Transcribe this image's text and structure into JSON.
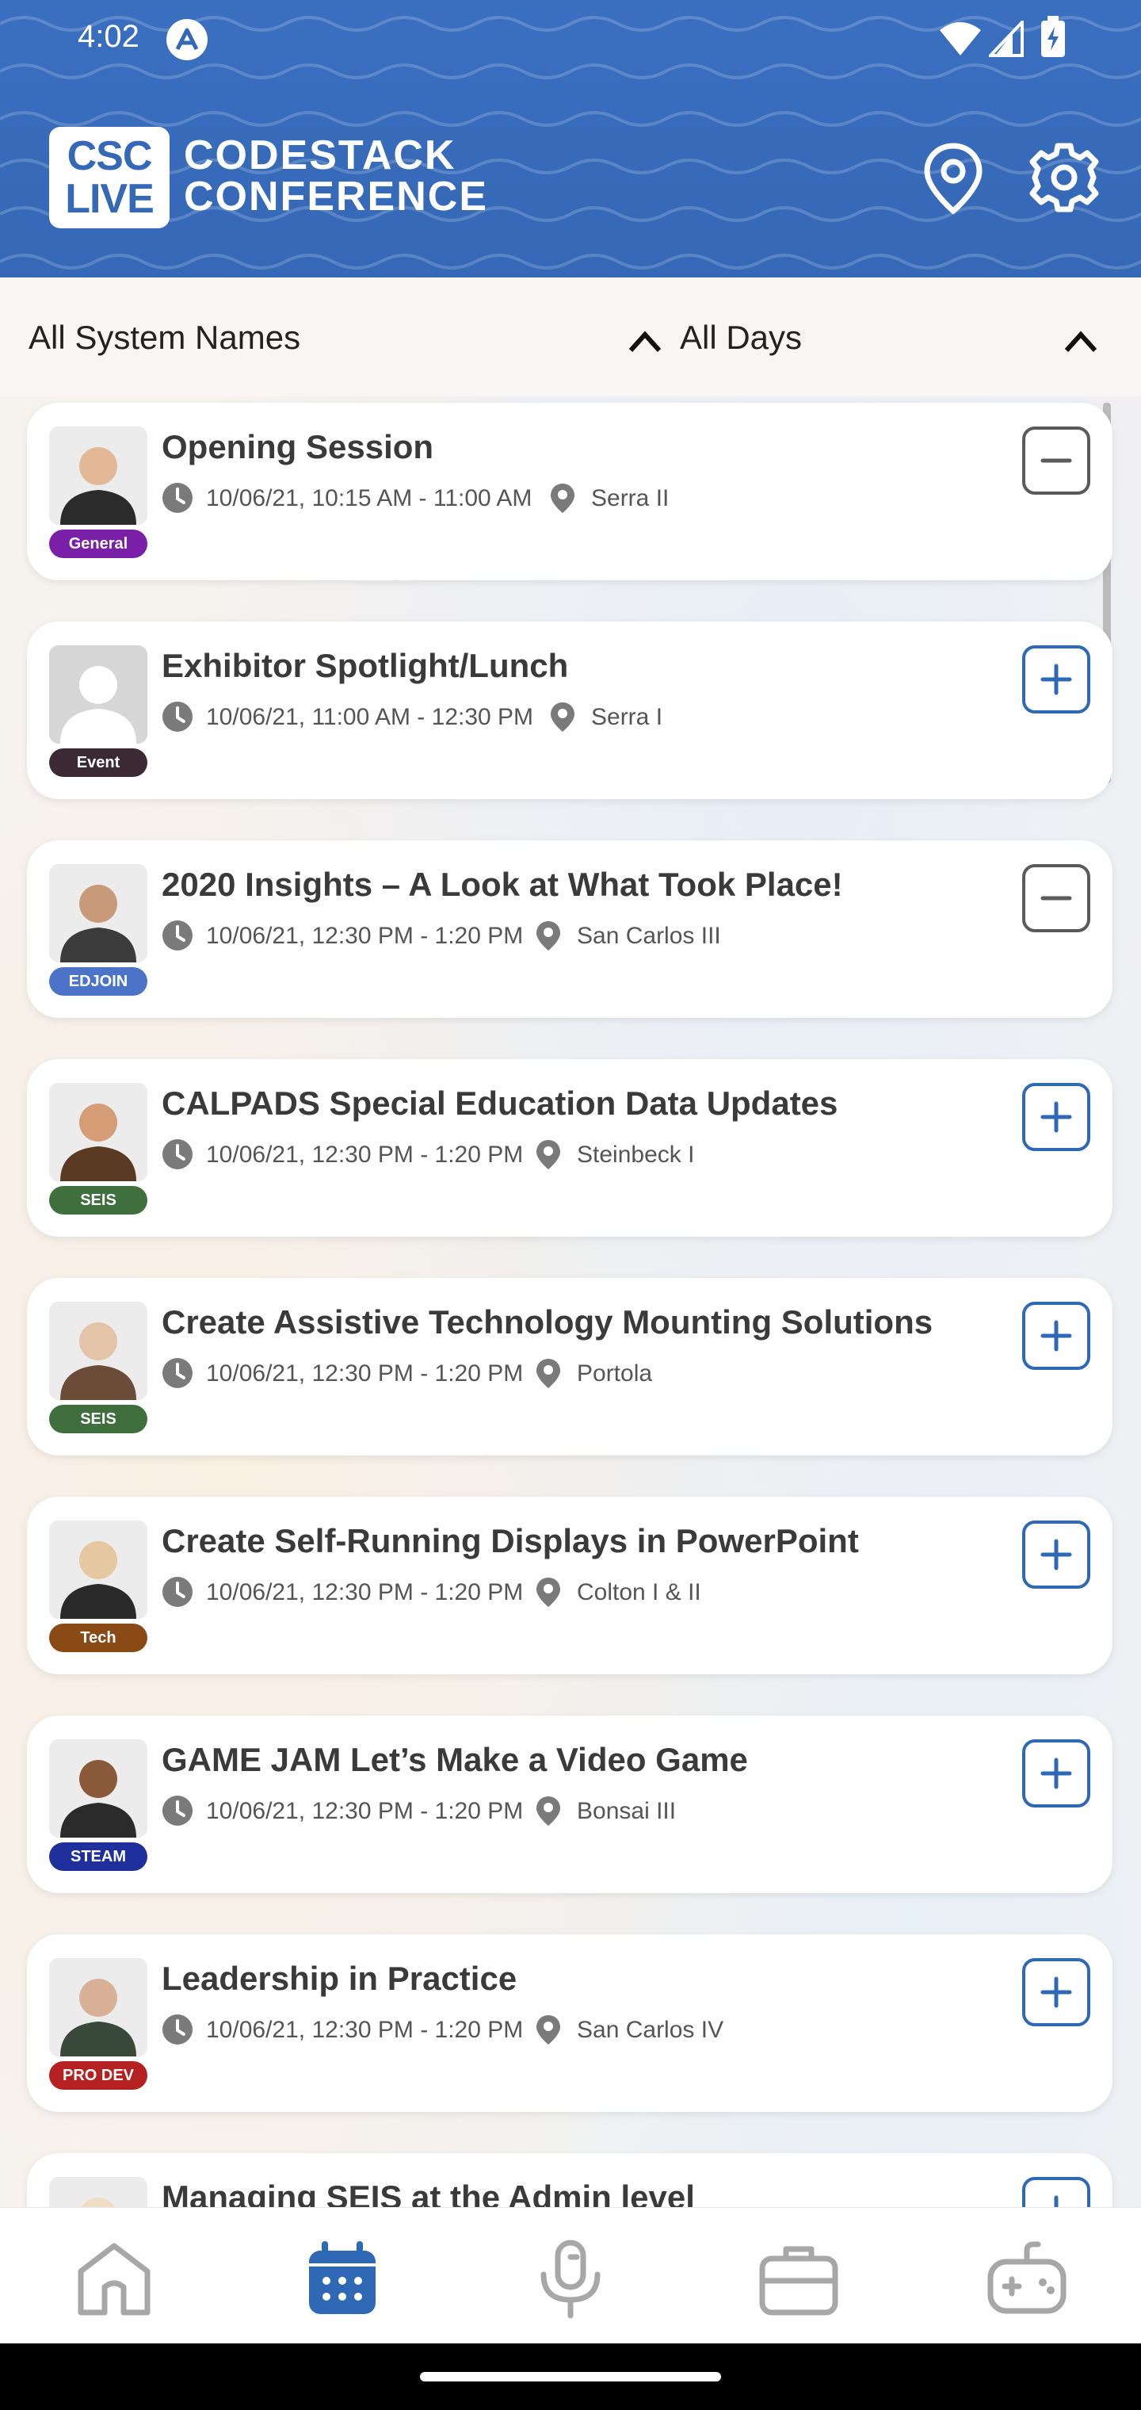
{
  "status_bar": {
    "time": "4:02"
  },
  "header": {
    "logo_badge_line1": "CSC",
    "logo_badge_line2": "LIVE",
    "logo_line1": "CODESTACK",
    "logo_line2": "CONFERENCE",
    "colors": {
      "header_bg": "#3568b6",
      "accent": "#2f68b4"
    }
  },
  "filters": {
    "system_names": "All System Names",
    "days": "All Days"
  },
  "sessions": [
    {
      "title": "Opening Session",
      "time": "10/06/21, 10:15 AM - 11:00 AM",
      "room": "Serra II",
      "tag": "General",
      "tag_color": "#7a1fa8",
      "action": "remove"
    },
    {
      "title": "Exhibitor Spotlight/Lunch",
      "time": "10/06/21, 11:00 AM - 12:30 PM",
      "room": "Serra I",
      "tag": "Event",
      "tag_color": "#3b2a33",
      "action": "add"
    },
    {
      "title": "2020 Insights – A Look at What Took Place!",
      "time": "10/06/21, 12:30 PM - 1:20 PM",
      "room": "San Carlos III",
      "tag": "EDJOIN",
      "tag_color": "#4b74c8",
      "action": "remove"
    },
    {
      "title": "CALPADS Special Education Data Updates",
      "time": "10/06/21, 12:30 PM - 1:20 PM",
      "room": "Steinbeck I",
      "tag": "SEIS",
      "tag_color": "#3f6f3c",
      "action": "add"
    },
    {
      "title": "Create Assistive Technology Mounting Solutions",
      "time": "10/06/21, 12:30 PM - 1:20 PM",
      "room": "Portola",
      "tag": "SEIS",
      "tag_color": "#3f6f3c",
      "action": "add"
    },
    {
      "title": "Create Self-Running Displays in PowerPoint",
      "time": "10/06/21, 12:30 PM - 1:20 PM",
      "room": "Colton I & II",
      "tag": "Tech",
      "tag_color": "#8a4a16",
      "action": "add"
    },
    {
      "title": "GAME JAM Let’s Make a Video Game",
      "time": "10/06/21, 12:30 PM - 1:20 PM",
      "room": "Bonsai III",
      "tag": "STEAM",
      "tag_color": "#1f2f9c",
      "action": "add"
    },
    {
      "title": "Leadership in Practice",
      "time": "10/06/21, 12:30 PM - 1:20 PM",
      "room": "San Carlos IV",
      "tag": "PRO DEV",
      "tag_color": "#b52020",
      "action": "add"
    },
    {
      "title": "Managing SEIS at the Admin level",
      "time": "",
      "room": "",
      "tag": "",
      "tag_color": "#3f6f3c",
      "action": "add"
    }
  ],
  "bottom_nav": {
    "items": [
      "home-icon",
      "calendar-icon",
      "microphone-icon",
      "briefcase-icon",
      "gamepad-icon"
    ],
    "active": "calendar-icon"
  }
}
